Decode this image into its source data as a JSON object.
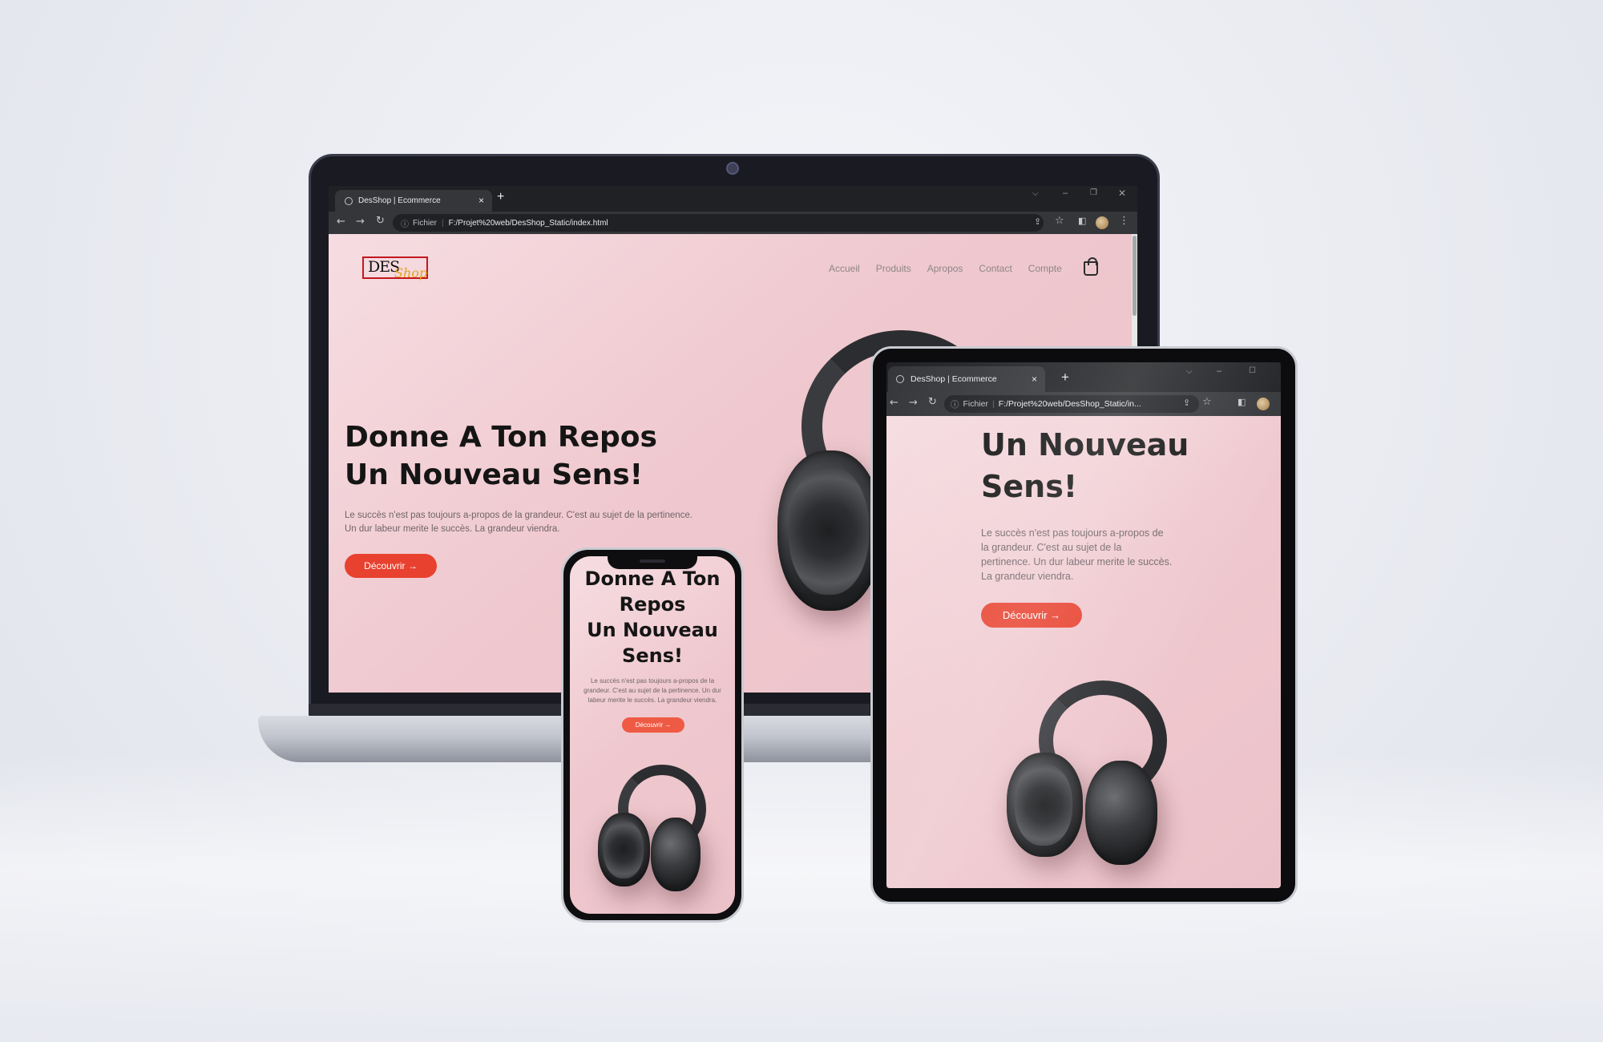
{
  "browser": {
    "tab_title": "DesShop | Ecommerce",
    "new_tab": "+",
    "close_tab": "×",
    "security_label": "Fichier",
    "url_desktop": "F:/Projet%20web/DesShop_Static/index.html",
    "url_tablet": "F:/Projet%20web/DesShop_Static/in..."
  },
  "site": {
    "logo": {
      "primary": "DES",
      "secondary": "Shop"
    },
    "nav": [
      "Accueil",
      "Produits",
      "Apropos",
      "Contact",
      "Compte"
    ],
    "hero": {
      "title_line1": "Donne A Ton Repos",
      "title_line2": "Un Nouveau Sens!",
      "tablet_title_line1": "Un Nouveau",
      "tablet_title_line2": "Sens!",
      "phone_title_line1": "Donne A Ton",
      "phone_title_line2": "Repos",
      "phone_title_line3": "Un Nouveau",
      "phone_title_line4": "Sens!",
      "text_desktop_line1": "Le succès n'est pas toujours a-propos de la grandeur. C'est au sujet de la pertinence.",
      "text_desktop_line2": "Un dur labeur merite le succès. La grandeur viendra.",
      "text_tablet_line1": "Le succès n'est pas toujours a-propos de",
      "text_tablet_line2": "la grandeur. C'est au sujet de la",
      "text_tablet_line3": "pertinence. Un dur labeur merite le succès.",
      "text_tablet_line4": "La grandeur viendra.",
      "text_phone_line1": "Le succès n'est pas toujours a-propos de la",
      "text_phone_line2": "grandeur. C'est au sujet de la pertinence. Un dur",
      "text_phone_line3": "labeur merite le succès. La grandeur viendra.",
      "cta": "Découvrir →"
    }
  },
  "colors": {
    "accent": "#e8412f",
    "hero_bg": "#efc9cf",
    "chrome_dark": "#202124",
    "chrome_bar": "#35363a"
  },
  "icons": [
    "globe-icon",
    "close-icon",
    "plus-icon",
    "back-arrow-icon",
    "forward-arrow-icon",
    "reload-icon",
    "info-icon",
    "share-icon",
    "star-icon",
    "sidebar-icon",
    "avatar-icon",
    "more-icon",
    "shopping-bag-icon",
    "minimize-icon",
    "restore-icon",
    "dropdown-icon"
  ]
}
